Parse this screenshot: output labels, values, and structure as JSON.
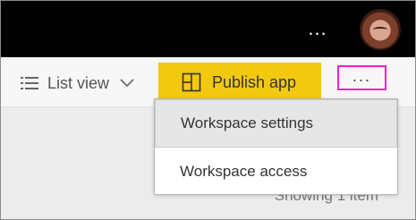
{
  "topbar": {
    "more_label": "...",
    "avatar_label": "Account avatar"
  },
  "toolbar": {
    "list_view_label": "List view",
    "publish_label": "Publish app",
    "more_label": "...",
    "highlight_color": "#ee22cc"
  },
  "dropdown": {
    "items": [
      {
        "label": "Workspace settings"
      },
      {
        "label": "Workspace access"
      }
    ]
  },
  "content": {
    "showing_text": "Showing 1 item"
  },
  "colors": {
    "topbar": "#000000",
    "publish_button": "#f2c811"
  }
}
